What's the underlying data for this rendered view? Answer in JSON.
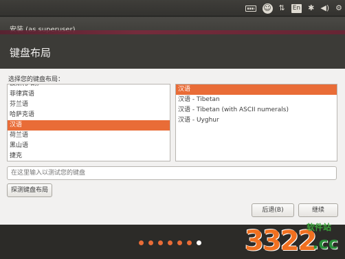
{
  "panel": {
    "lang_indicator": "En",
    "icons": [
      "keyboard-icon",
      "accessibility-icon",
      "network-icon",
      "language-icon",
      "bluetooth-icon",
      "volume-icon",
      "settings-gear-icon"
    ]
  },
  "window": {
    "title": "安装 (as superuser)"
  },
  "header": {
    "title": "键盘布局"
  },
  "content": {
    "prompt": "选择您的键盘布局：",
    "layouts": [
      "菲律宾语",
      "芬兰语",
      "哈萨克语",
      "汉语",
      "荷兰语",
      "黑山语",
      "捷克"
    ],
    "partial_top_layout": "波斯(伊朗)",
    "selected_layout": "汉语",
    "variants": [
      "汉语",
      "汉语 - Tibetan",
      "汉语 - Tibetan (with ASCII numerals)",
      "汉语 - Uyghur"
    ],
    "selected_variant": "汉语",
    "test_placeholder": "在这里输入以测试您的键盘",
    "detect_button": "探测键盘布局"
  },
  "footer": {
    "back_button": "后退(B)",
    "continue_button": "继续",
    "progress_total": 7,
    "progress_current": 7
  },
  "watermark": {
    "number": "3322",
    "sub": "软件站",
    "cc": ".cc"
  },
  "colors": {
    "accent": "#e96c37",
    "panel": "#3c3b37",
    "titlebar_strip": "#7a2a3c",
    "content_bg": "#f2f1f0"
  }
}
